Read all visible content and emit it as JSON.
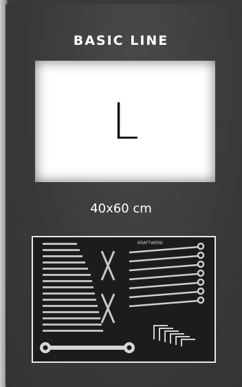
{
  "product": {
    "line_title": "BASIC LINE",
    "size_letter": "L",
    "dimensions": "40x60 cm"
  },
  "tray_image": {
    "logo_text": "KRAFTWERK",
    "icon": "wrench-tray-image"
  },
  "colors": {
    "background": "#3a3a3a",
    "text": "#ffffff",
    "size_box": "#ffffff",
    "tray_border": "#e8e8e8"
  }
}
